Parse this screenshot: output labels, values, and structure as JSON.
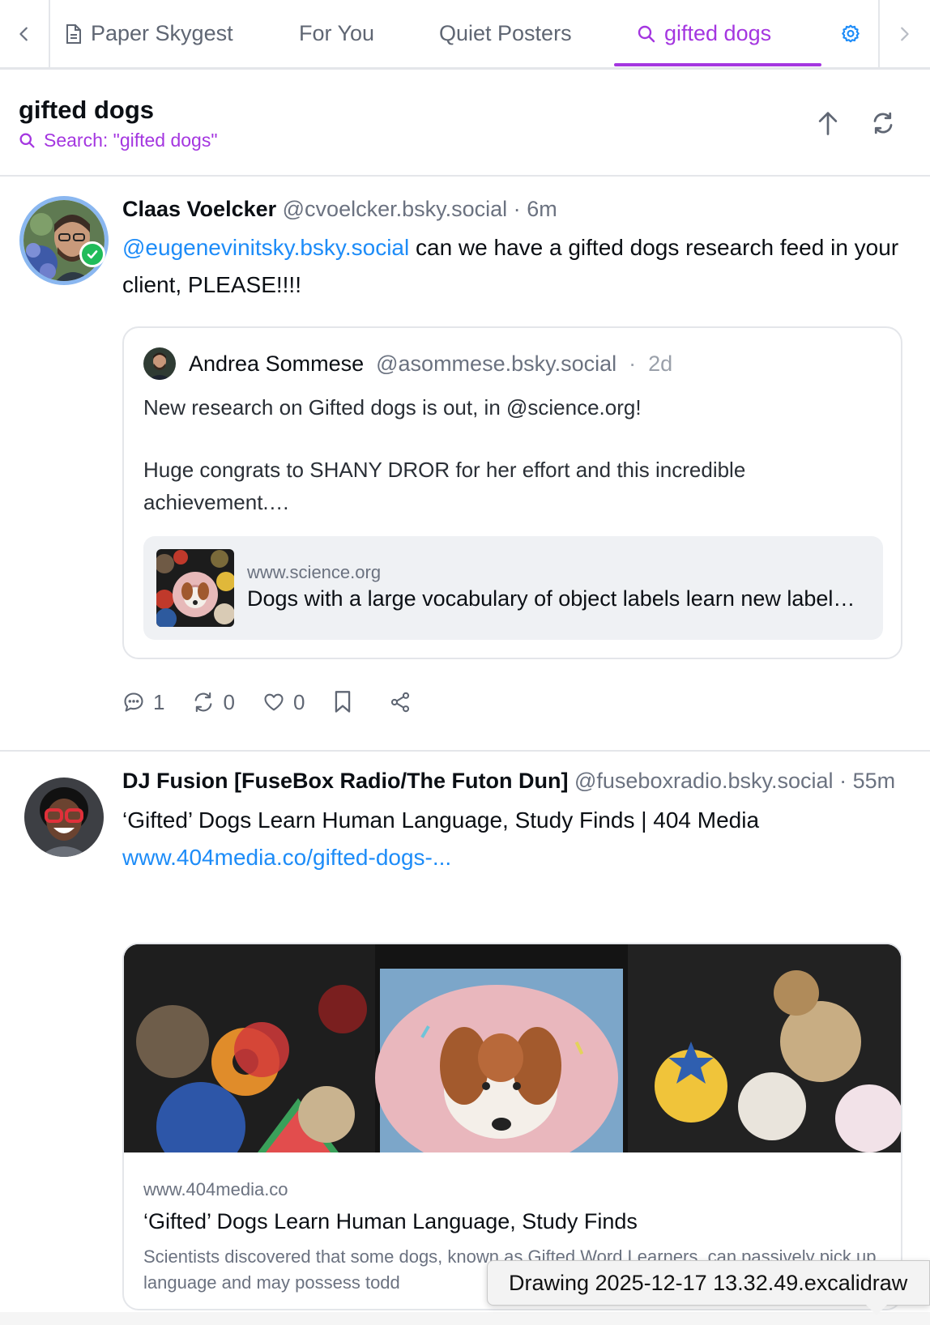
{
  "tabs": [
    {
      "label": "Paper Skygest",
      "icon": "document-icon"
    },
    {
      "label": "For You"
    },
    {
      "label": "Quiet Posters"
    },
    {
      "label": "gifted dogs",
      "icon": "search-icon",
      "active": true
    }
  ],
  "feed": {
    "title": "gifted dogs",
    "subtitle": "Search: \"gifted dogs\""
  },
  "posts": [
    {
      "author": "Claas Voelcker",
      "handle": "@cvoelcker.bsky.social",
      "sep": "·",
      "time": "6m",
      "mention": "@eugenevinitsky.bsky.social",
      "text_after_mention": " can we have a gifted dogs research feed in your client, PLEASE!!!!",
      "quote": {
        "author": "Andrea Sommese",
        "handle": "@asommese.bsky.social",
        "sep": "·",
        "time": "2d",
        "line1": "New research on Gifted dogs is out, in @science.org!",
        "line2": "Huge congrats to SHANY DROR for her effort and this incredible achievement.…",
        "link_card": {
          "domain": "www.science.org",
          "title": "Dogs with a large vocabulary of object labels learn new labels by overhearing"
        }
      },
      "actions": {
        "replies": "1",
        "reposts": "0",
        "likes": "0"
      }
    },
    {
      "author": "DJ Fusion [FuseBox Radio/The Futon Dun]",
      "handle": "@fuseboxradio.bsky.social",
      "sep": "·",
      "time": "55m",
      "text": "‘Gifted’ Dogs Learn Human Language, Study Finds | 404 Media",
      "link_text": "www.404media.co/gifted-dogs-...",
      "embed": {
        "domain": "www.404media.co",
        "title": "‘Gifted’ Dogs Learn Human Language, Study Finds",
        "description": "Scientists discovered that some dogs, known as Gifted Word Learners, can passively pick up language and may possess todd"
      }
    }
  ],
  "tooltip": "Drawing 2025-12-17 13.32.49.excalidraw",
  "colors": {
    "accent": "#a436e0",
    "link": "#1d8cf8",
    "verified": "#20bc5a",
    "muted": "#6b7280"
  }
}
